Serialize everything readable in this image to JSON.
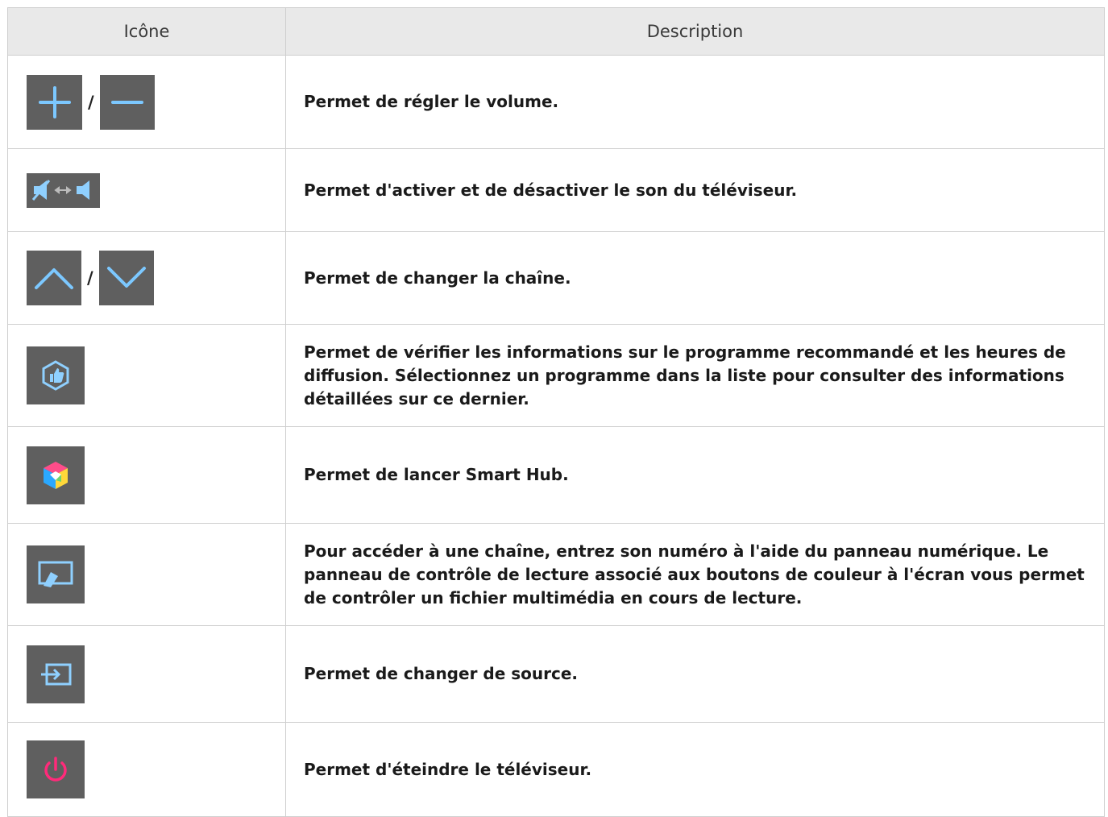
{
  "table": {
    "headers": {
      "icon": "Icône",
      "description": "Description"
    },
    "rows": [
      {
        "icons": [
          "plus-icon",
          "minus-icon"
        ],
        "separator": "/",
        "description": "Permet de régler le volume."
      },
      {
        "icons": [
          "mute-toggle-icon"
        ],
        "description": "Permet d'activer et de désactiver le son du téléviseur."
      },
      {
        "icons": [
          "chevron-up-icon",
          "chevron-down-icon"
        ],
        "separator": "/",
        "description": "Permet de changer la chaîne."
      },
      {
        "icons": [
          "recommend-icon"
        ],
        "description": "Permet de vérifier les informations sur le programme recommandé et les heures de diffusion. Sélectionnez un programme dans la liste pour consulter des informations détaillées sur ce dernier."
      },
      {
        "icons": [
          "smart-hub-icon"
        ],
        "description": "Permet de lancer Smart Hub."
      },
      {
        "icons": [
          "number-panel-icon"
        ],
        "description": "Pour accéder à une chaîne, entrez son numéro à l'aide du panneau numérique. Le panneau de contrôle de lecture associé aux boutons de couleur à l'écran vous permet de contrôler un fichier multimédia en cours de lecture."
      },
      {
        "icons": [
          "source-icon"
        ],
        "description": "Permet de changer de source."
      },
      {
        "icons": [
          "power-icon"
        ],
        "description": "Permet d'éteindre le téléviseur."
      }
    ]
  },
  "colors": {
    "tile_bg": "#5f5f5f",
    "icon_glow": "#38a8ff",
    "power_accent": "#ff2a7a"
  }
}
